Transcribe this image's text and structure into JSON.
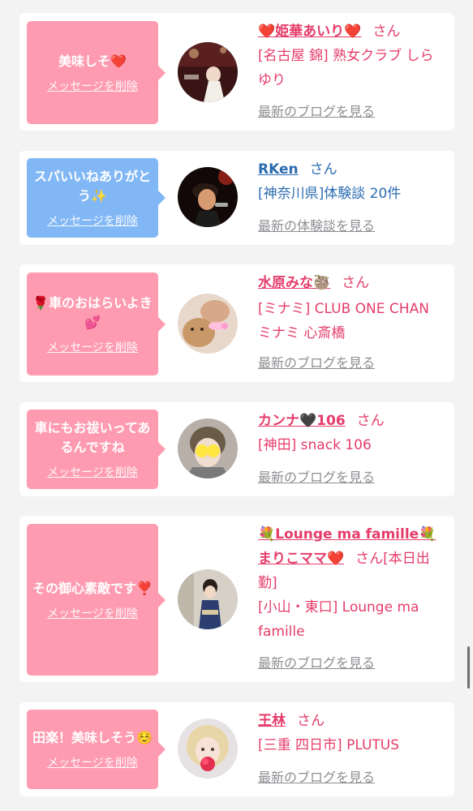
{
  "colors": {
    "pink_bubble": "#fe9bb0",
    "blue_bubble": "#82b7f6",
    "pink_text": "#e53c6a",
    "blue_text": "#2b6cb0",
    "gray_link": "#8e8e93"
  },
  "cards": [
    {
      "bubble_text": "美味しそ❤️",
      "bubble_delete": "メッセージを削除",
      "name": "❤️姫華あいり❤️",
      "honorific": "さん",
      "shop": "[名古屋 錦] 熟女クラブ しらゆり",
      "link": "最新のブログを見る",
      "avatar_icon": "avatar-photo-dark-room"
    },
    {
      "bubble_text": "スパいいねありがとう✨",
      "bubble_delete": "メッセージを削除",
      "name": "RKen",
      "honorific": "さん",
      "shop": "[神奈川県]体験談 20件",
      "link": "最新の体験談を見る",
      "avatar_icon": "avatar-photo-singer"
    },
    {
      "bubble_text": "🌹車のおはらいよき💕",
      "bubble_delete": "メッセージを削除",
      "name": "水原みな🦥",
      "honorific": "さん",
      "shop": "[ミナミ] CLUB ONE CHAN ミナミ 心斎橋",
      "link": "最新のブログを見る",
      "avatar_icon": "avatar-photo-bear"
    },
    {
      "bubble_text": "車にもお祓いってあるんですね",
      "bubble_delete": "メッセージを削除",
      "name": "カンナ🖤106",
      "honorific": "さん",
      "shop": "[神田] snack 106",
      "link": "最新のブログを見る",
      "avatar_icon": "avatar-photo-sparkle-face"
    },
    {
      "bubble_text": "その御心素敵です❣️",
      "bubble_delete": "メッセージを削除",
      "name": "💐Lounge ma famille💐まりこママ❤️",
      "honorific": "さん",
      "extra": "[本日出勤]",
      "shop": "[小山・東口] Lounge ma famille",
      "link": "最新のブログを見る",
      "avatar_icon": "avatar-photo-kimono"
    },
    {
      "bubble_text": "田楽！美味しそう☺️",
      "bubble_delete": "メッセージを削除",
      "name": "王林",
      "honorific": "さん",
      "shop": "[三重 四日市] PLUTUS",
      "link": "最新のブログを見る",
      "avatar_icon": "avatar-photo-blonde"
    }
  ]
}
